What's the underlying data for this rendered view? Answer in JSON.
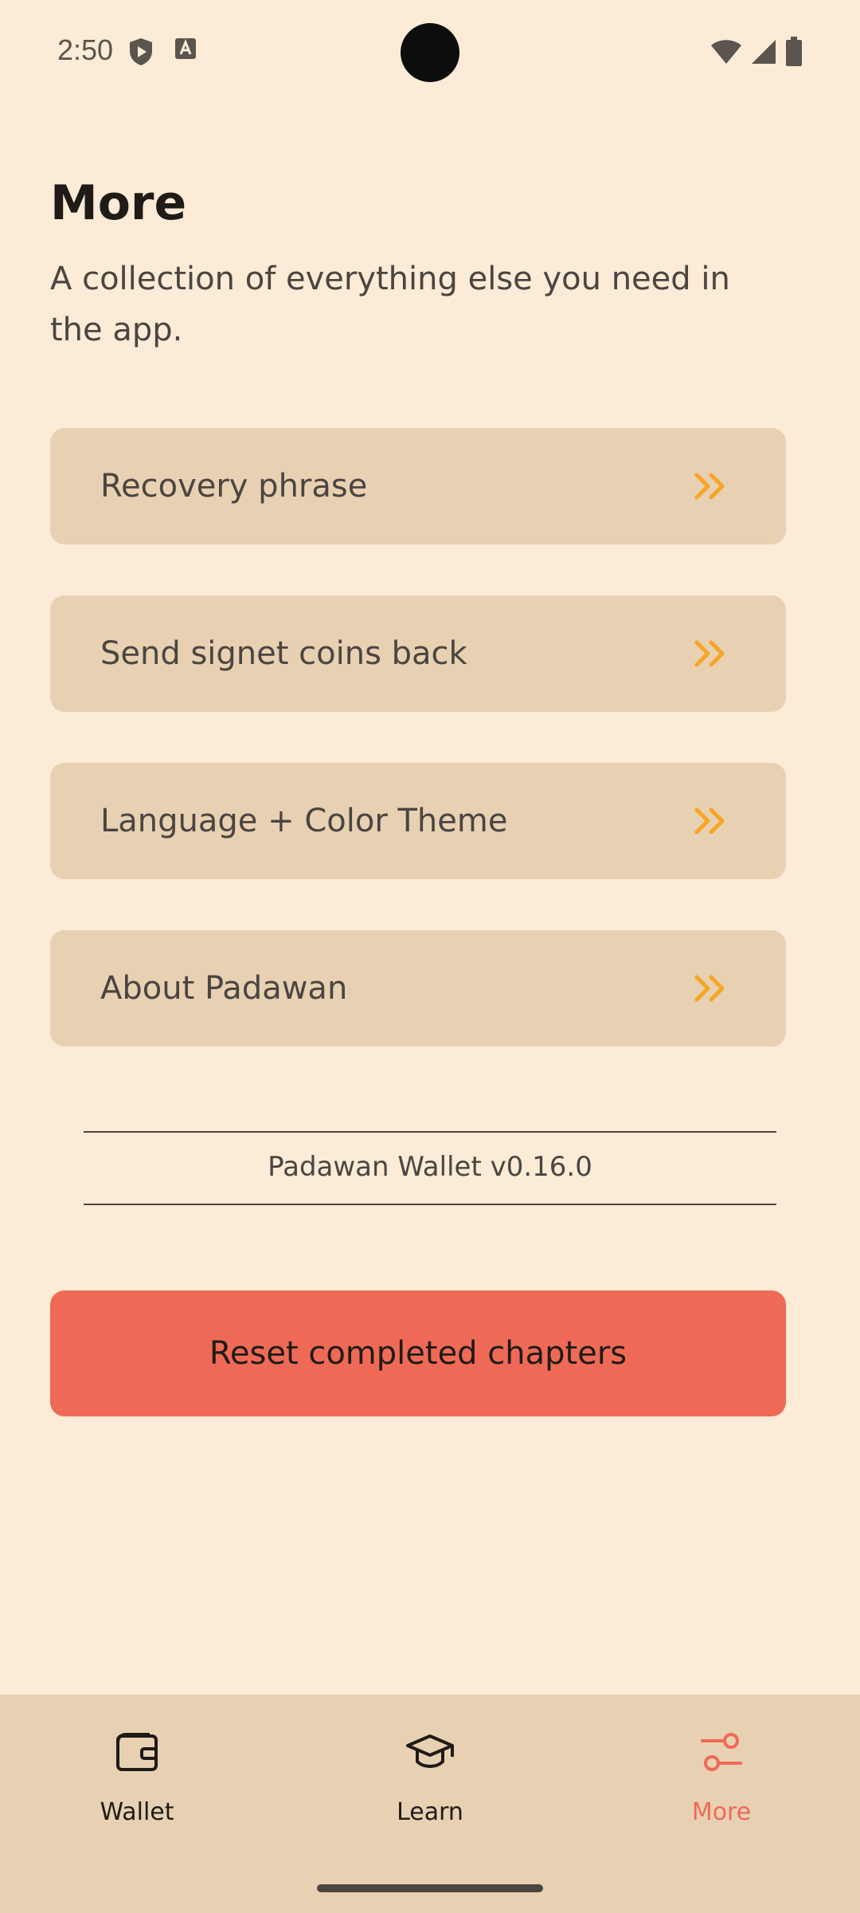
{
  "status_bar": {
    "time": "2:50",
    "icons": [
      "shield-play-icon",
      "keyboard-a-icon",
      "wifi-icon",
      "signal-icon",
      "battery-icon"
    ]
  },
  "header": {
    "title": "More",
    "subtitle": "A collection of everything else you need in the app."
  },
  "menu": {
    "items": [
      {
        "label": "Recovery phrase",
        "icon": "double-chevron-right-icon"
      },
      {
        "label": "Send signet coins back",
        "icon": "double-chevron-right-icon"
      },
      {
        "label": "Language + Color Theme",
        "icon": "double-chevron-right-icon"
      },
      {
        "label": "About Padawan",
        "icon": "double-chevron-right-icon"
      }
    ]
  },
  "version": {
    "text": "Padawan Wallet v0.16.0"
  },
  "reset": {
    "label": "Reset completed chapters"
  },
  "bottom_nav": {
    "items": [
      {
        "label": "Wallet",
        "icon": "wallet-icon",
        "active": false
      },
      {
        "label": "Learn",
        "icon": "graduation-cap-icon",
        "active": false
      },
      {
        "label": "More",
        "icon": "sliders-icon",
        "active": true
      }
    ]
  },
  "colors": {
    "background": "#fcebd6",
    "card": "#e8d0b3",
    "accent_orange": "#f5a623",
    "accent_red": "#ef6a56",
    "text_dark": "#1f1b16",
    "text_muted": "#4a4540"
  }
}
